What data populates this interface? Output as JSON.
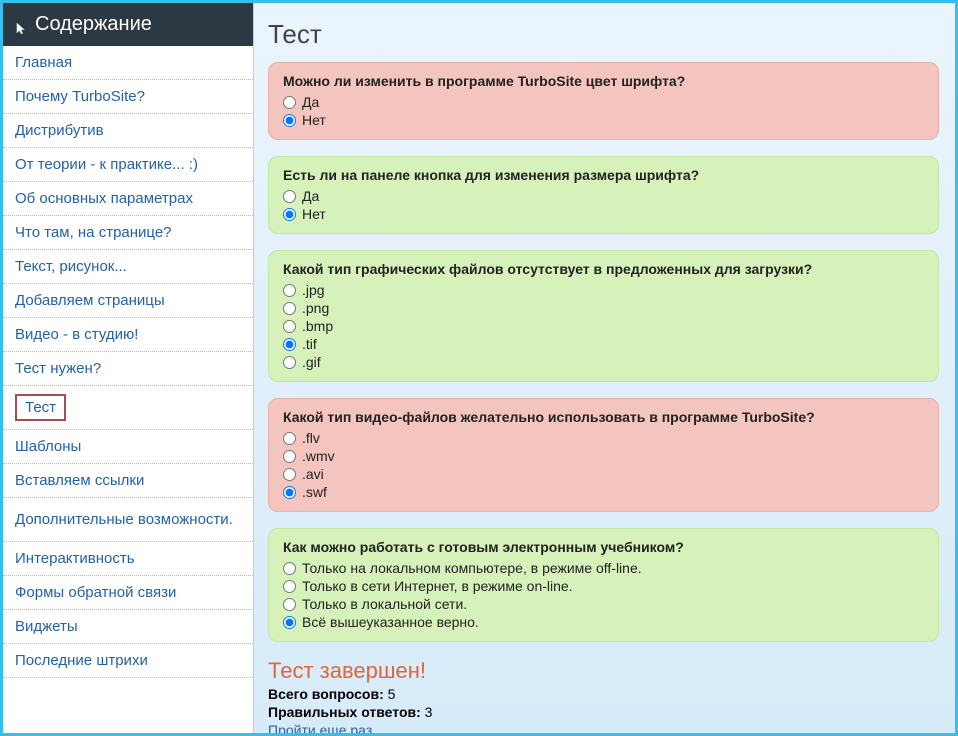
{
  "sidebar": {
    "title": "Содержание",
    "items": [
      {
        "label": "Главная"
      },
      {
        "label": "Почему TurboSite?"
      },
      {
        "label": "Дистрибутив"
      },
      {
        "label": "От теории - к практике... :)"
      },
      {
        "label": "Об основных параметрах"
      },
      {
        "label": "Что там, на странице?"
      },
      {
        "label": "Текст, рисунок..."
      },
      {
        "label": "Добавляем страницы"
      },
      {
        "label": "Видео - в студию!"
      },
      {
        "label": "Тест нужен?"
      },
      {
        "label": "Тест",
        "selected": true
      },
      {
        "label": "Шаблоны"
      },
      {
        "label": "Вставляем ссылки"
      },
      {
        "label": "Дополнительные возможности.",
        "multiline": true
      },
      {
        "label": "Интерактивность"
      },
      {
        "label": "Формы обратной связи"
      },
      {
        "label": "Виджеты"
      },
      {
        "label": "Последние штрихи"
      }
    ]
  },
  "main": {
    "title": "Тест",
    "questions": [
      {
        "text": "Можно ли изменить в программе TurboSite цвет шрифта?",
        "status": "wrong",
        "options": [
          {
            "label": "Да",
            "checked": false
          },
          {
            "label": "Нет",
            "checked": true
          }
        ]
      },
      {
        "text": "Есть ли на панеле кнопка для изменения размера шрифта?",
        "status": "right",
        "options": [
          {
            "label": "Да",
            "checked": false
          },
          {
            "label": "Нет",
            "checked": true
          }
        ]
      },
      {
        "text": "Какой тип графических файлов отсутствует в предложенных для загрузки?",
        "status": "right",
        "options": [
          {
            "label": ".jpg",
            "checked": false
          },
          {
            "label": ".png",
            "checked": false
          },
          {
            "label": ".bmp",
            "checked": false
          },
          {
            "label": ".tif",
            "checked": true
          },
          {
            "label": ".gif",
            "checked": false
          }
        ]
      },
      {
        "text": "Какой тип видео-файлов желательно использовать в программе TurboSite?",
        "status": "wrong",
        "options": [
          {
            "label": ".flv",
            "checked": false
          },
          {
            "label": ".wmv",
            "checked": false
          },
          {
            "label": ".avi",
            "checked": false
          },
          {
            "label": ".swf",
            "checked": true
          }
        ]
      },
      {
        "text": "Как можно работать с готовым электронным учебником?",
        "status": "right",
        "options": [
          {
            "label": "Только на локальном компьютере, в режиме off-line.",
            "checked": false
          },
          {
            "label": "Только в сети Интернет, в режиме on-line.",
            "checked": false
          },
          {
            "label": "Только в локальной сети.",
            "checked": false
          },
          {
            "label": "Всё вышеуказанное верно.",
            "checked": true
          }
        ]
      }
    ],
    "result": {
      "title": "Тест завершен!",
      "total_label": "Всего вопросов:",
      "total": "5",
      "correct_label": "Правильных ответов:",
      "correct": "3",
      "retry": "Пройти еще раз"
    }
  }
}
